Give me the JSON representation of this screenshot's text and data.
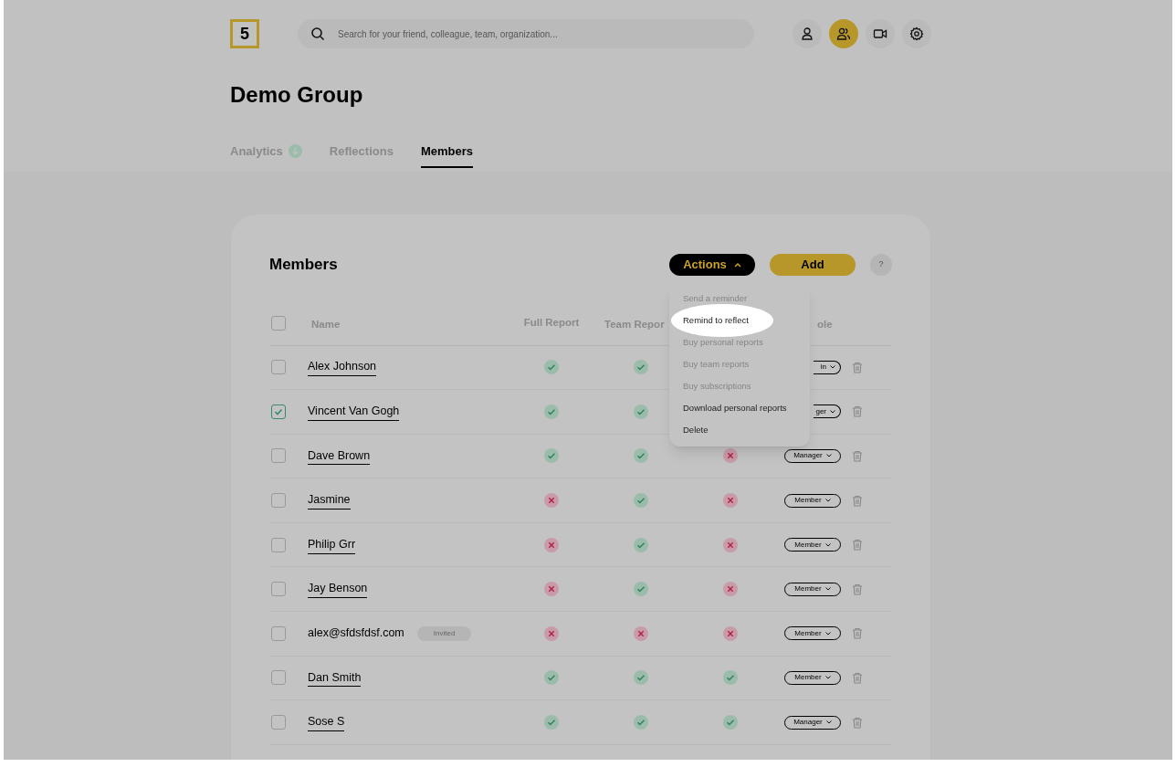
{
  "logo": {
    "text": "5"
  },
  "search": {
    "placeholder": "Search for your friend, colleague, team, organization..."
  },
  "nav_buttons": [
    {
      "kind": "person",
      "selected": false
    },
    {
      "kind": "people",
      "selected": true
    },
    {
      "kind": "video",
      "selected": false
    },
    {
      "kind": "settings",
      "selected": false
    }
  ],
  "title": "Demo Group",
  "tabs": [
    {
      "label": "Analytics",
      "badge": true,
      "selected": false
    },
    {
      "label": "Reflections",
      "badge": false,
      "selected": false
    },
    {
      "label": "Members",
      "badge": false,
      "selected": true
    }
  ],
  "card": {
    "title": "Members",
    "actions_button": "Actions",
    "add_button": "Add",
    "help": "?",
    "select_all": {
      "checked": false
    },
    "columns": [
      "Name",
      "Full Report",
      "Team Repor",
      "ole"
    ],
    "rows": [
      {
        "name": "Alex Johnson",
        "invited": false,
        "checked": false,
        "full": true,
        "team": true,
        "third": null,
        "role": "in",
        "role_cut": true
      },
      {
        "name": "Vincent Van Gogh",
        "invited": false,
        "checked": true,
        "full": true,
        "team": true,
        "third": null,
        "role": "ger",
        "role_cut": true
      },
      {
        "name": "Dave Brown",
        "invited": false,
        "checked": false,
        "full": true,
        "team": true,
        "third": false,
        "role": "Manager"
      },
      {
        "name": "Jasmine",
        "invited": false,
        "checked": false,
        "full": false,
        "team": true,
        "third": false,
        "role": "Member"
      },
      {
        "name": "Philip Grr",
        "invited": false,
        "checked": false,
        "full": false,
        "team": true,
        "third": false,
        "role": "Member"
      },
      {
        "name": "Jay Benson",
        "invited": false,
        "checked": false,
        "full": false,
        "team": true,
        "third": false,
        "role": "Member"
      },
      {
        "name": "alex@sfdsfdsf.com",
        "invited": true,
        "invited_label": "Invited",
        "checked": false,
        "full": false,
        "team": false,
        "third": false,
        "role": "Member"
      },
      {
        "name": "Dan Smith",
        "invited": false,
        "checked": false,
        "full": true,
        "team": true,
        "third": true,
        "role": "Member"
      },
      {
        "name": "Sose S",
        "invited": false,
        "checked": false,
        "full": true,
        "team": true,
        "third": true,
        "role": "Manager"
      }
    ],
    "menu": [
      {
        "label": "Send a reminder",
        "disabled": true,
        "highlighted": false
      },
      {
        "label": "Remind to reflect",
        "disabled": false,
        "highlighted": true
      },
      {
        "label": "Buy personal reports",
        "disabled": true,
        "highlighted": false
      },
      {
        "label": "Buy team reports",
        "disabled": true,
        "highlighted": false
      },
      {
        "label": "Buy subscriptions",
        "disabled": true,
        "highlighted": false
      },
      {
        "label": "Download personal reports",
        "disabled": false,
        "highlighted": false
      },
      {
        "label": "Delete",
        "disabled": false,
        "highlighted": false
      }
    ]
  }
}
